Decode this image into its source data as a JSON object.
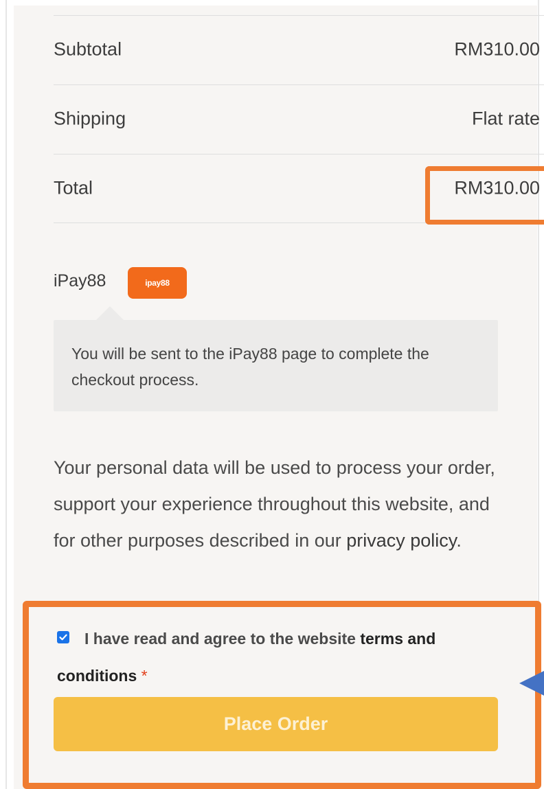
{
  "order_summary": {
    "subtotal_label": "Subtotal",
    "subtotal_value": "RM310.00",
    "shipping_label": "Shipping",
    "shipping_value": "Flat rate",
    "total_label": "Total",
    "total_value": "RM310.00"
  },
  "payment": {
    "method_label": "iPay88",
    "logo_text": "ipay88",
    "description": "You will be sent to the iPay88 page to complete the checkout process."
  },
  "privacy": {
    "text": "Your personal data will be used to process your order, support your experience throughout this website, and for other purposes described in our ",
    "link_text": "privacy policy",
    "suffix": "."
  },
  "terms": {
    "checked": true,
    "text_prefix": "I have read and agree to the website ",
    "link_text": "terms and conditions",
    "required_mark": "*"
  },
  "actions": {
    "place_order_label": "Place Order"
  },
  "colors": {
    "accent_button": "#f5bf45",
    "annotation_orange": "#ef7c31",
    "annotation_blue": "#4472c4",
    "ipay88_brand": "#f26a1b",
    "checkbox_blue": "#1a73e8"
  }
}
